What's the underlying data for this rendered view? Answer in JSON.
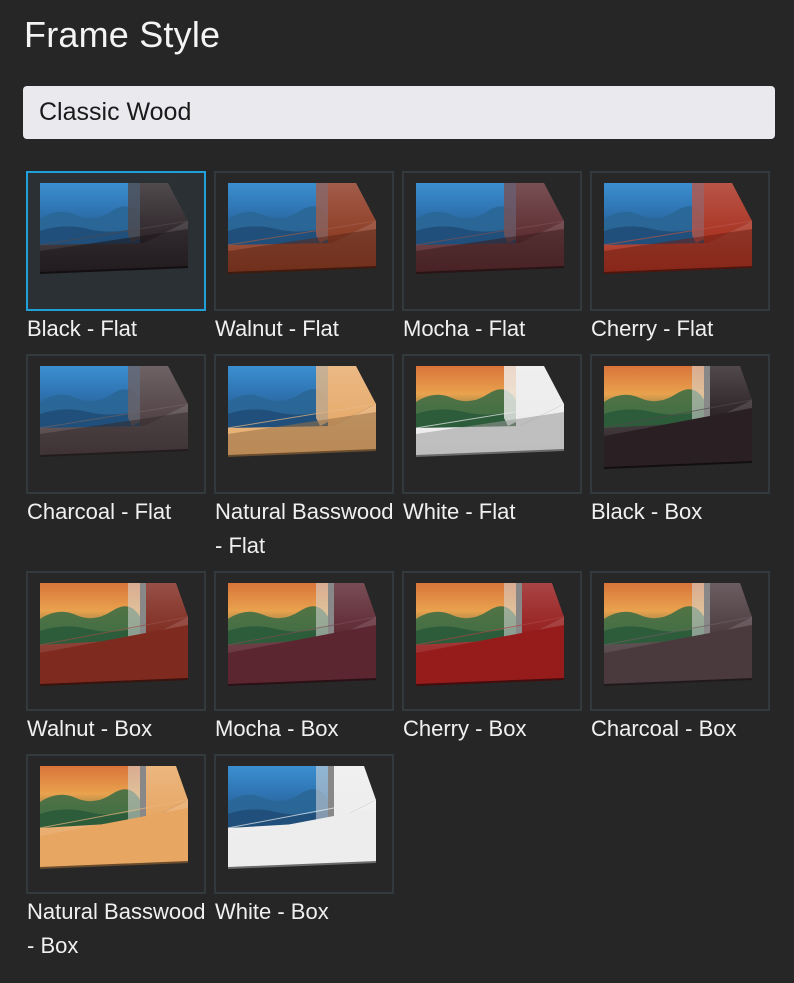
{
  "title": "Frame Style",
  "dropdown": {
    "selected": "Classic Wood"
  },
  "colors": {
    "selected_border": "#1fa0d8",
    "tile_border": "#333a3e",
    "background": "#262626"
  },
  "frames": [
    {
      "label": "Black - Flat",
      "style": "flat",
      "color": "#2a2226",
      "sky": "blue",
      "selected": true
    },
    {
      "label": "Walnut - Flat",
      "style": "flat",
      "color": "#8c3a22",
      "sky": "blue",
      "selected": false
    },
    {
      "label": "Mocha - Flat",
      "style": "flat",
      "color": "#5a2a2e",
      "sky": "blue",
      "selected": false
    },
    {
      "label": "Cherry - Flat",
      "style": "flat",
      "color": "#a8301f",
      "sky": "blue",
      "selected": false
    },
    {
      "label": "Charcoal - Flat",
      "style": "flat",
      "color": "#4e3f42",
      "sky": "blue",
      "selected": false
    },
    {
      "label": "Natural Basswood - Flat",
      "style": "flat",
      "color": "#e6aa6a",
      "sky": "blue",
      "selected": false
    },
    {
      "label": "White - Flat",
      "style": "flat",
      "color": "#ececec",
      "sky": "sunset",
      "selected": false
    },
    {
      "label": "Black - Box",
      "style": "box",
      "color": "#2a2024",
      "sky": "sunset",
      "selected": false
    },
    {
      "label": "Walnut - Box",
      "style": "box",
      "color": "#7f2a1e",
      "sky": "sunset",
      "selected": false
    },
    {
      "label": "Mocha - Box",
      "style": "box",
      "color": "#5c2630",
      "sky": "sunset",
      "selected": false
    },
    {
      "label": "Cherry - Box",
      "style": "box",
      "color": "#961c1c",
      "sky": "sunset",
      "selected": false
    },
    {
      "label": "Charcoal - Box",
      "style": "box",
      "color": "#4a3a3e",
      "sky": "sunset",
      "selected": false
    },
    {
      "label": "Natural Basswood - Box",
      "style": "box",
      "color": "#e7a662",
      "sky": "sunset",
      "selected": false
    },
    {
      "label": "White - Box",
      "style": "box",
      "color": "#ededed",
      "sky": "blue",
      "selected": false
    }
  ]
}
